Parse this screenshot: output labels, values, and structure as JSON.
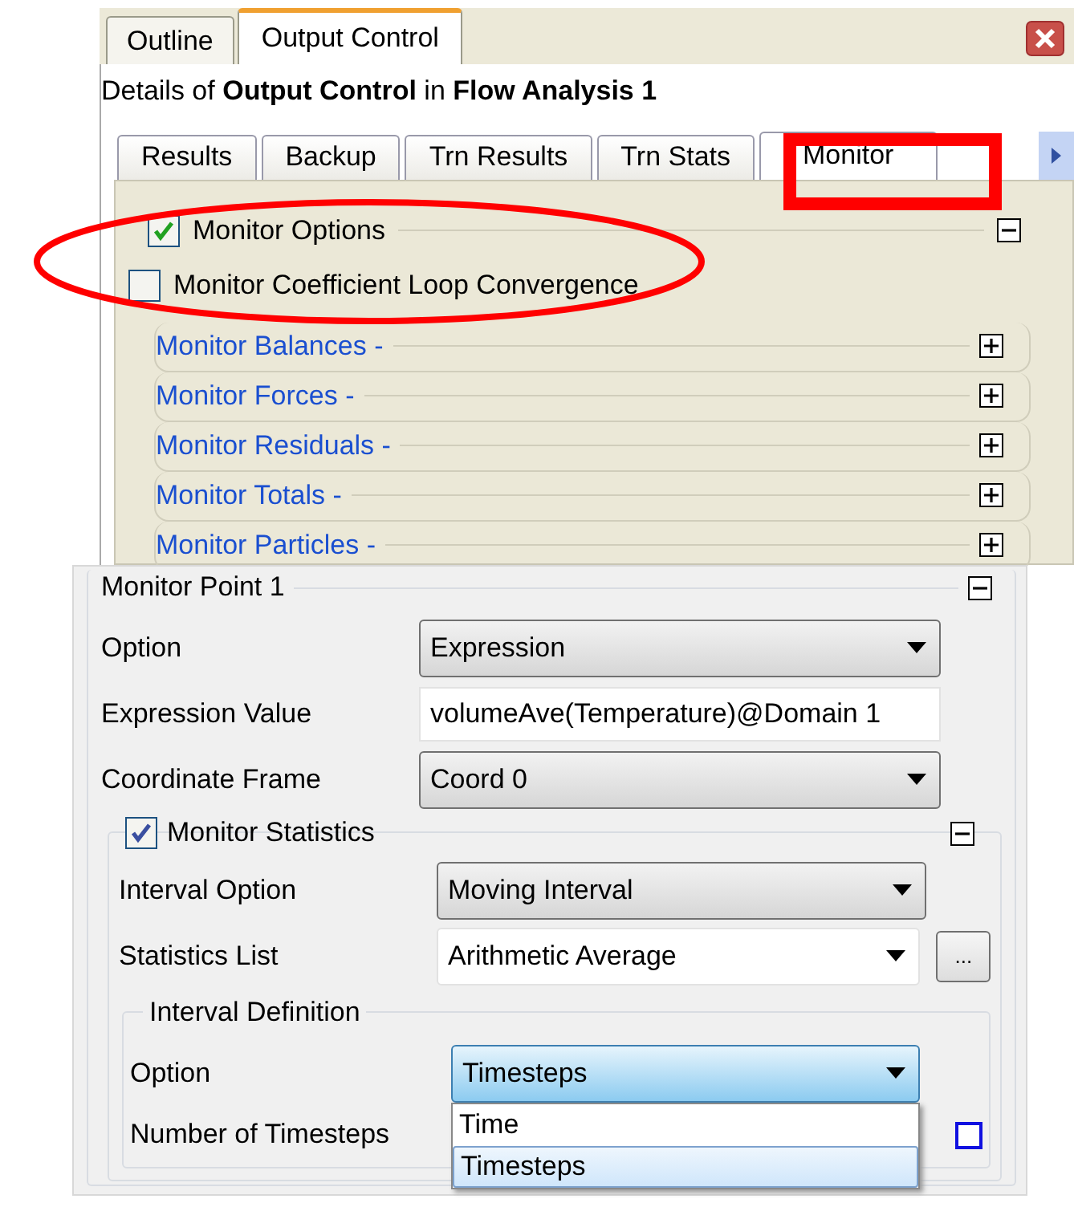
{
  "top_tabs": [
    {
      "label": "Outline",
      "selected": false
    },
    {
      "label": "Output Control",
      "selected": true
    }
  ],
  "details_title": "Details of **Output Control** in **Flow Analysis 1**",
  "sub_tabs": [
    {
      "label": "Results",
      "selected": false
    },
    {
      "label": "Backup",
      "selected": false
    },
    {
      "label": "Trn Results",
      "selected": false
    },
    {
      "label": "Trn Stats",
      "selected": false
    },
    {
      "label": "Monitor",
      "selected": true
    }
  ],
  "monitor_options": {
    "label": "Monitor Options",
    "checked": true,
    "expanded": true
  },
  "coefficient_loop": {
    "label": "Monitor Coefficient Loop Convergence",
    "checked": false
  },
  "sections": [
    {
      "label": "Monitor Balances -",
      "expanded": false
    },
    {
      "label": "Monitor Forces -",
      "expanded": false
    },
    {
      "label": "Monitor Residuals -",
      "expanded": false
    },
    {
      "label": "Monitor Totals -",
      "expanded": false
    },
    {
      "label": "Monitor Particles -",
      "expanded": false
    }
  ],
  "monitor_point": {
    "title": "Monitor Point 1",
    "expanded": true,
    "fields": [
      {
        "kind": "select",
        "label": "Option",
        "value": "Expression"
      },
      {
        "kind": "text",
        "label": "Expression Value",
        "value": "volumeAve(Temperature)@Domain 1"
      },
      {
        "kind": "select",
        "label": "Coordinate Frame",
        "value": "Coord 0"
      }
    ]
  },
  "statistics": {
    "label": "Monitor Statistics",
    "checked": true,
    "expanded": true,
    "fields": [
      {
        "kind": "select",
        "label": "Interval Option",
        "value": "Moving Interval"
      },
      {
        "kind": "combo",
        "label": "Statistics List",
        "value": "Arithmetic Average",
        "button": "..."
      }
    ]
  },
  "interval_definition": {
    "title": "Interval Definition",
    "option": {
      "label": "Option",
      "value": "Timesteps",
      "open": true,
      "options": [
        {
          "label": "Time",
          "selected": false
        },
        {
          "label": "Timesteps",
          "selected": true
        }
      ]
    },
    "timesteps": {
      "label": "Number of Timesteps",
      "checked": false
    }
  },
  "annotations": [
    {
      "kind": "ellipse"
    },
    {
      "kind": "rectangle"
    }
  ]
}
